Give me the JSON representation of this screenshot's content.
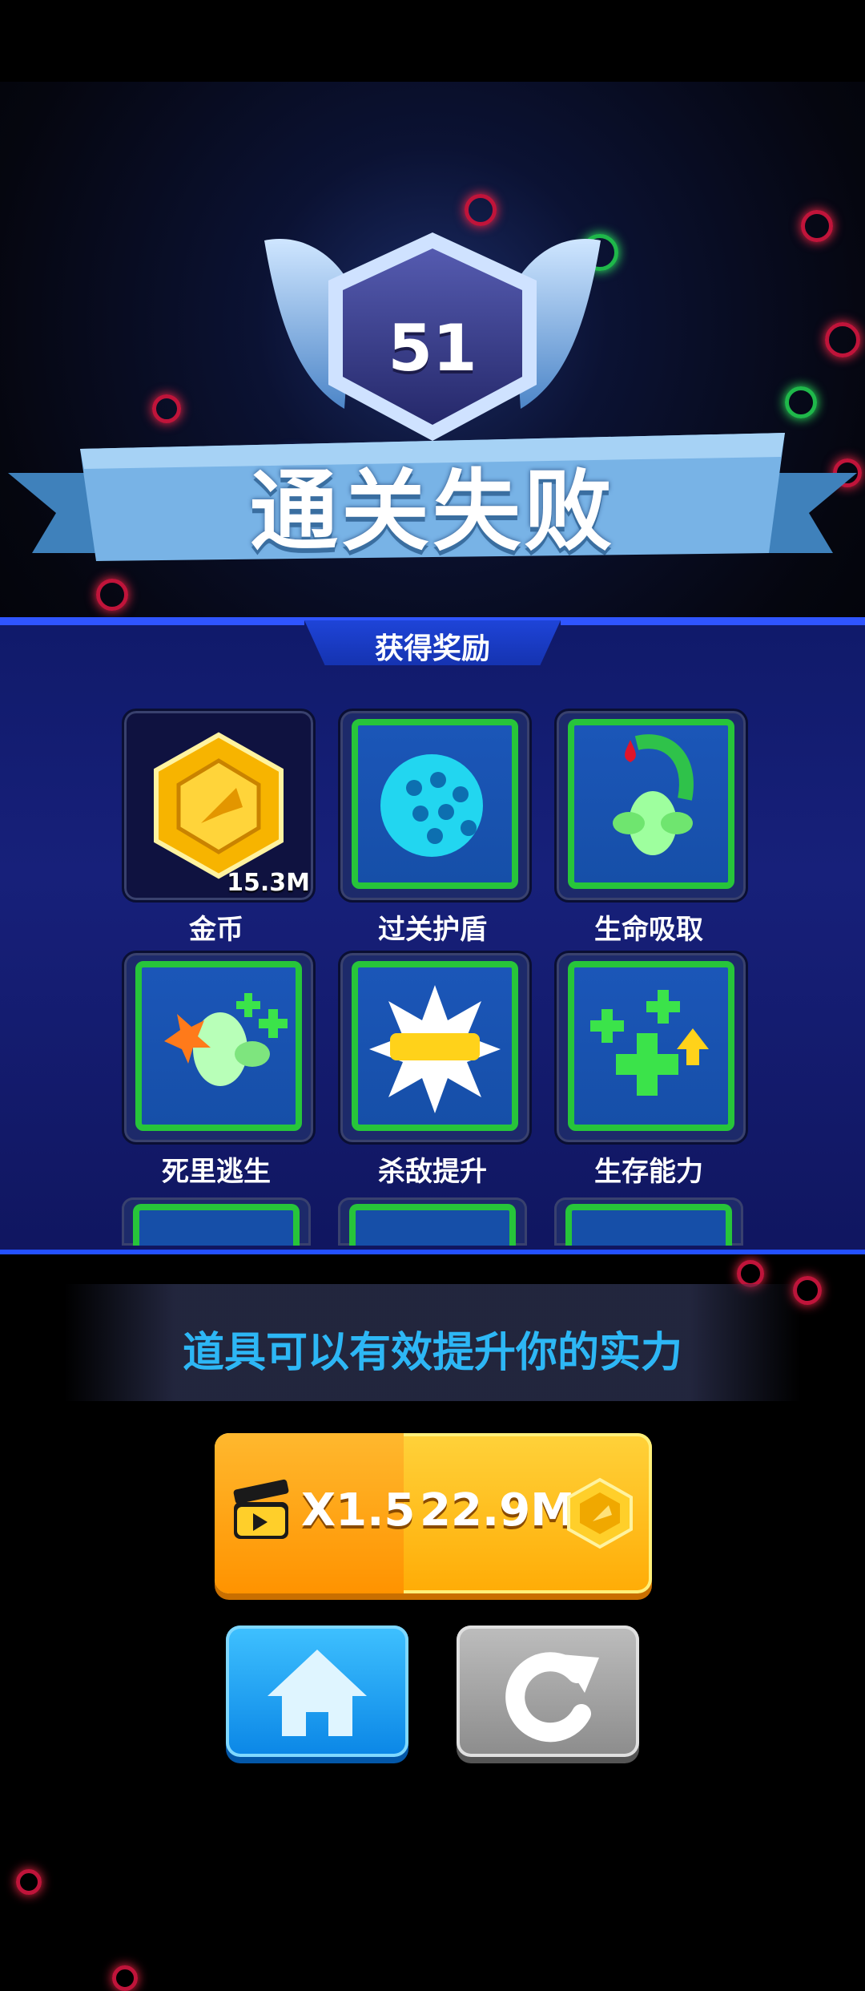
{
  "result": {
    "level": "51",
    "title": "通关失败"
  },
  "rewards": {
    "header": "获得奖励",
    "items": [
      {
        "label": "金币",
        "amount": "15.3M",
        "icon": "gold-coin-icon"
      },
      {
        "label": "过关护盾",
        "icon": "shield-dome-icon"
      },
      {
        "label": "生命吸取",
        "icon": "life-steal-icon"
      },
      {
        "label": "死里逃生",
        "icon": "last-stand-icon"
      },
      {
        "label": "杀敌提升",
        "icon": "lucky-burst-icon"
      },
      {
        "label": "生存能力",
        "icon": "survival-plus-icon"
      }
    ]
  },
  "tip": "道具可以有效提升你的实力",
  "ad_reward": {
    "multiplier": "X1.5",
    "amount": "22.9M"
  },
  "colors": {
    "accent_blue": "#2db7f5",
    "panel": "#17207a",
    "item_border": "#27c53a",
    "gold": "#ffc21a"
  }
}
